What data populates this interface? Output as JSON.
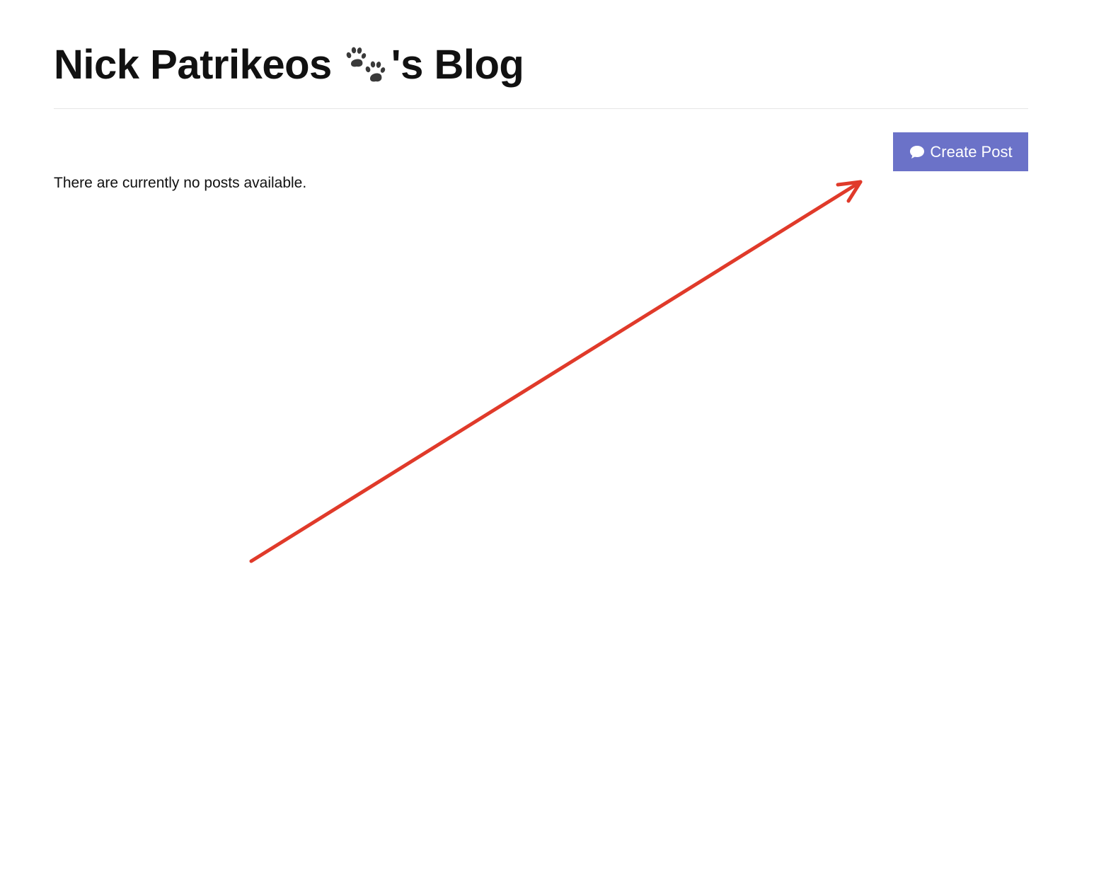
{
  "colors": {
    "accent": "#6b72c8",
    "annotation": "#e03a2a"
  },
  "header": {
    "title_prefix": "Nick Patrikeos",
    "title_suffix": "'s Blog",
    "title_icon": "paw-prints-icon"
  },
  "toolbar": {
    "create_post_label": "Create Post",
    "create_post_icon": "comment-icon"
  },
  "posts": {
    "empty_message": "There are currently no posts available."
  },
  "annotation": {
    "type": "arrow",
    "points_to": "create-post-button"
  }
}
